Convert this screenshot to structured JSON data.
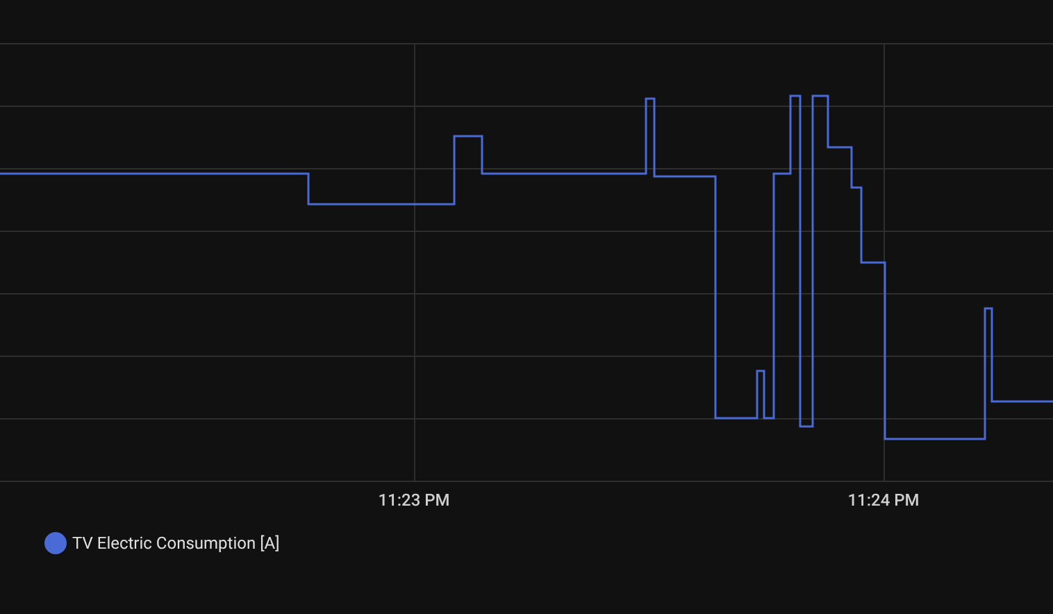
{
  "chart": {
    "x_tick_labels": [
      "11:23 PM",
      "11:24 PM"
    ],
    "legend": [
      {
        "label": "TV Electric Consumption [A]",
        "color": "#4a6bd6"
      }
    ]
  }
}
